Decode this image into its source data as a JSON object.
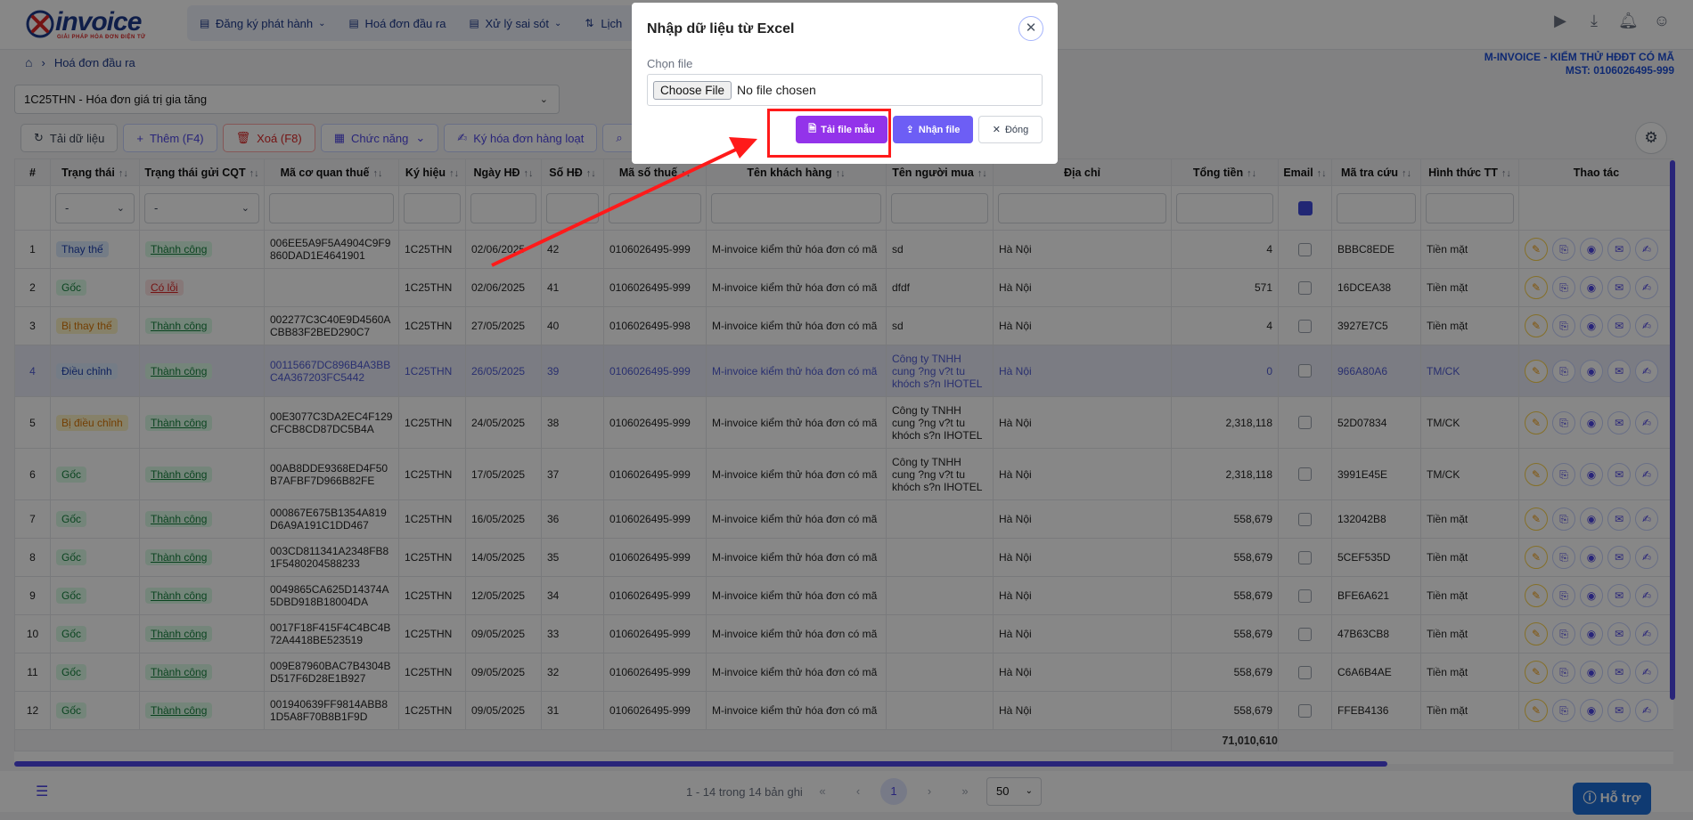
{
  "nav": {
    "logo_text": "invoice",
    "logo_subtitle": "GIẢI PHÁP HÓA ĐƠN ĐIỆN TỬ",
    "menu": [
      {
        "label": "Đăng ký phát hành"
      },
      {
        "label": "Hoá đơn đầu ra"
      },
      {
        "label": "Xử lý sai sót"
      },
      {
        "label": "Lịch"
      }
    ]
  },
  "breadcrumb": {
    "current": "Hoá đơn đầu ra"
  },
  "company": {
    "name": "M-INVOICE - KIỂM THỬ HĐĐT CÓ MÃ",
    "tax_code": "MST: 0106026495-999"
  },
  "series_select": {
    "value": "1C25THN - Hóa đơn giá trị gia tăng"
  },
  "toolbar": {
    "reload": "Tải dữ liệu",
    "add": "Thêm (F4)",
    "delete": "Xoá (F8)",
    "functions": "Chức năng",
    "sign": "Ký hóa đơn hàng loạt"
  },
  "table": {
    "headers": [
      "#",
      "Trạng thái",
      "Trạng thái gửi CQT",
      "Mã cơ quan thuế",
      "Ký hiệu",
      "Ngày HĐ",
      "Số HĐ",
      "Mã số thuế",
      "Tên khách hàng",
      "Tên người mua",
      "Địa chỉ",
      "Tổng tiền",
      "Email",
      "Mã tra cứu",
      "Hình thức TT",
      "Thao tác"
    ],
    "filter_select_placeholder": "-",
    "rows": [
      {
        "no": "1",
        "status": "Thay thế",
        "status_kind": "thay",
        "cqt": "Thành công",
        "cqt_kind": "ok",
        "tax_auth_code": "006EE5A9F5A4904C9F9860DAD1E4641901",
        "symbol": "1C25THN",
        "date": "02/06/2025",
        "number": "42",
        "tax_id": "0106026495-999",
        "customer": "M-invoice kiểm thử hóa đơn có mã",
        "buyer": "sd",
        "address": "Hà Nội",
        "total": "4",
        "lookup": "BBBC8EDE",
        "payment": "Tiền mặt"
      },
      {
        "no": "2",
        "status": "Gốc",
        "status_kind": "goc",
        "cqt": "Có lỗi",
        "cqt_kind": "err",
        "tax_auth_code": "",
        "symbol": "1C25THN",
        "date": "02/06/2025",
        "number": "41",
        "tax_id": "0106026495-999",
        "customer": "M-invoice kiểm thử hóa đơn có mã",
        "buyer": "dfdf",
        "address": "Hà Nội",
        "total": "571",
        "lookup": "16DCEA38",
        "payment": "Tiền mặt"
      },
      {
        "no": "3",
        "status": "Bị thay thế",
        "status_kind": "bithay",
        "cqt": "Thành công",
        "cqt_kind": "ok",
        "tax_auth_code": "002277C3C40E9D4560ACBB83F2BED290C7",
        "symbol": "1C25THN",
        "date": "27/05/2025",
        "number": "40",
        "tax_id": "0106026495-998",
        "customer": "M-invoice kiểm thử hóa đơn có mã",
        "buyer": "sd",
        "address": "Hà Nội",
        "total": "4",
        "lookup": "3927E7C5",
        "payment": "Tiền mặt"
      },
      {
        "no": "4",
        "status": "Điều chỉnh",
        "status_kind": "dc",
        "cqt": "Thành công",
        "cqt_kind": "ok",
        "tax_auth_code": "00115667DC896B4A3BBC4A367203FC5442",
        "symbol": "1C25THN",
        "date": "26/05/2025",
        "number": "39",
        "tax_id": "0106026495-999",
        "customer": "M-invoice kiểm thử hóa đơn có mã",
        "buyer": "Công ty TNHH cung ?ng v?t tu khóch s?n IHOTEL",
        "address": "Hà Nội",
        "total": "0",
        "lookup": "966A80A6",
        "payment": "TM/CK"
      },
      {
        "no": "5",
        "status": "Bị điều chỉnh",
        "status_kind": "bidc",
        "cqt": "Thành công",
        "cqt_kind": "ok",
        "tax_auth_code": "00E3077C3DA2EC4F129CFCB8CD87DC5B4A",
        "symbol": "1C25THN",
        "date": "24/05/2025",
        "number": "38",
        "tax_id": "0106026495-999",
        "customer": "M-invoice kiểm thử hóa đơn có mã",
        "buyer": "Công ty TNHH cung ?ng v?t tu khóch s?n IHOTEL",
        "address": "Hà Nội",
        "total": "2,318,118",
        "lookup": "52D07834",
        "payment": "TM/CK"
      },
      {
        "no": "6",
        "status": "Gốc",
        "status_kind": "goc",
        "cqt": "Thành công",
        "cqt_kind": "ok",
        "tax_auth_code": "00AB8DDE9368ED4F50B7AFBF7D966B82FE",
        "symbol": "1C25THN",
        "date": "17/05/2025",
        "number": "37",
        "tax_id": "0106026495-999",
        "customer": "M-invoice kiểm thử hóa đơn có mã",
        "buyer": "Công ty TNHH cung ?ng v?t tu khóch s?n IHOTEL",
        "address": "Hà Nội",
        "total": "2,318,118",
        "lookup": "3991E45E",
        "payment": "TM/CK"
      },
      {
        "no": "7",
        "status": "Gốc",
        "status_kind": "goc",
        "cqt": "Thành công",
        "cqt_kind": "ok",
        "tax_auth_code": "000867E675B1354A819D6A9A191C1DD467",
        "symbol": "1C25THN",
        "date": "16/05/2025",
        "number": "36",
        "tax_id": "0106026495-999",
        "customer": "M-invoice kiểm thử hóa đơn có mã",
        "buyer": "",
        "address": "Hà Nội",
        "total": "558,679",
        "lookup": "132042B8",
        "payment": "Tiền mặt"
      },
      {
        "no": "8",
        "status": "Gốc",
        "status_kind": "goc",
        "cqt": "Thành công",
        "cqt_kind": "ok",
        "tax_auth_code": "003CD811341A2348FB81F5480204588233",
        "symbol": "1C25THN",
        "date": "14/05/2025",
        "number": "35",
        "tax_id": "0106026495-999",
        "customer": "M-invoice kiểm thử hóa đơn có mã",
        "buyer": "",
        "address": "Hà Nội",
        "total": "558,679",
        "lookup": "5CEF535D",
        "payment": "Tiền mặt"
      },
      {
        "no": "9",
        "status": "Gốc",
        "status_kind": "goc",
        "cqt": "Thành công",
        "cqt_kind": "ok",
        "tax_auth_code": "0049865CA625D14374A5DBD918B18004DA",
        "symbol": "1C25THN",
        "date": "12/05/2025",
        "number": "34",
        "tax_id": "0106026495-999",
        "customer": "M-invoice kiểm thử hóa đơn có mã",
        "buyer": "",
        "address": "Hà Nội",
        "total": "558,679",
        "lookup": "BFE6A621",
        "payment": "Tiền mặt"
      },
      {
        "no": "10",
        "status": "Gốc",
        "status_kind": "goc",
        "cqt": "Thành công",
        "cqt_kind": "ok",
        "tax_auth_code": "0017F18F415F4C4BC4B72A4418BE523519",
        "symbol": "1C25THN",
        "date": "09/05/2025",
        "number": "33",
        "tax_id": "0106026495-999",
        "customer": "M-invoice kiểm thử hóa đơn có mã",
        "buyer": "",
        "address": "Hà Nội",
        "total": "558,679",
        "lookup": "47B63CB8",
        "payment": "Tiền mặt"
      },
      {
        "no": "11",
        "status": "Gốc",
        "status_kind": "goc",
        "cqt": "Thành công",
        "cqt_kind": "ok",
        "tax_auth_code": "009E87960BAC7B4304BD517F6D28E1B927",
        "symbol": "1C25THN",
        "date": "09/05/2025",
        "number": "32",
        "tax_id": "0106026495-999",
        "customer": "M-invoice kiểm thử hóa đơn có mã",
        "buyer": "",
        "address": "Hà Nội",
        "total": "558,679",
        "lookup": "C6A6B4AE",
        "payment": "Tiền mặt"
      },
      {
        "no": "12",
        "status": "Gốc",
        "status_kind": "goc",
        "cqt": "Thành công",
        "cqt_kind": "ok",
        "tax_auth_code": "001940639FF9814ABB81D5A8F70B8B1F9D",
        "symbol": "1C25THN",
        "date": "09/05/2025",
        "number": "31",
        "tax_id": "0106026495-999",
        "customer": "M-invoice kiểm thử hóa đơn có mã",
        "buyer": "",
        "address": "Hà Nội",
        "total": "558,679",
        "lookup": "FFEB4136",
        "payment": "Tiền mặt"
      }
    ],
    "grand_total": "71,010,610"
  },
  "pager": {
    "range_text": "1 - 14 trong 14 bản ghi",
    "current_page": "1",
    "page_size": "50"
  },
  "help_button": "Hỗ trợ",
  "modal": {
    "title": "Nhập dữ liệu từ Excel",
    "file_label": "Chọn file",
    "choose_button": "Choose File",
    "no_file": "No file chosen",
    "download_template": "Tải file mẫu",
    "receive_file": "Nhận file",
    "close": "Đóng"
  },
  "colors": {
    "accent": "#4f46e5",
    "brand": "#1e3a8a",
    "download_btn": "#9333ea",
    "annotation": "#ff1a1a"
  }
}
